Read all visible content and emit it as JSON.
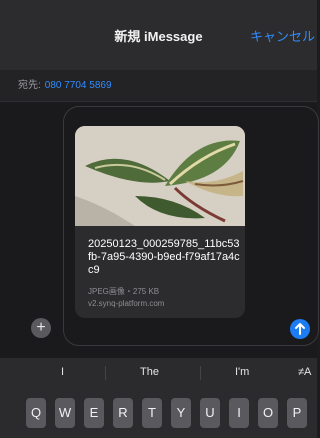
{
  "header": {
    "title": "新規 iMessage",
    "cancel_label": "キャンセル"
  },
  "recipient": {
    "label": "宛先:",
    "value": "080 7704 5869"
  },
  "attachment": {
    "filename": "20250123_000259785_11bc53fb-7a95-4390-b9ed-f79af17a4cc9",
    "meta": "JPEG画像・275 KB",
    "url": "v2.synq-platform.com"
  },
  "compose": {
    "plus_icon": "plus-icon",
    "send_icon": "send-arrow-icon"
  },
  "keyboard": {
    "suggestions": [
      "I",
      "The",
      "I'm"
    ],
    "overflow_suggestion": "≠A",
    "row1": [
      "Q",
      "W",
      "E",
      "R",
      "T",
      "Y",
      "U",
      "I",
      "O",
      "P"
    ]
  },
  "colors": {
    "accent": "#2f8cff",
    "send": "#1e7cf2"
  }
}
